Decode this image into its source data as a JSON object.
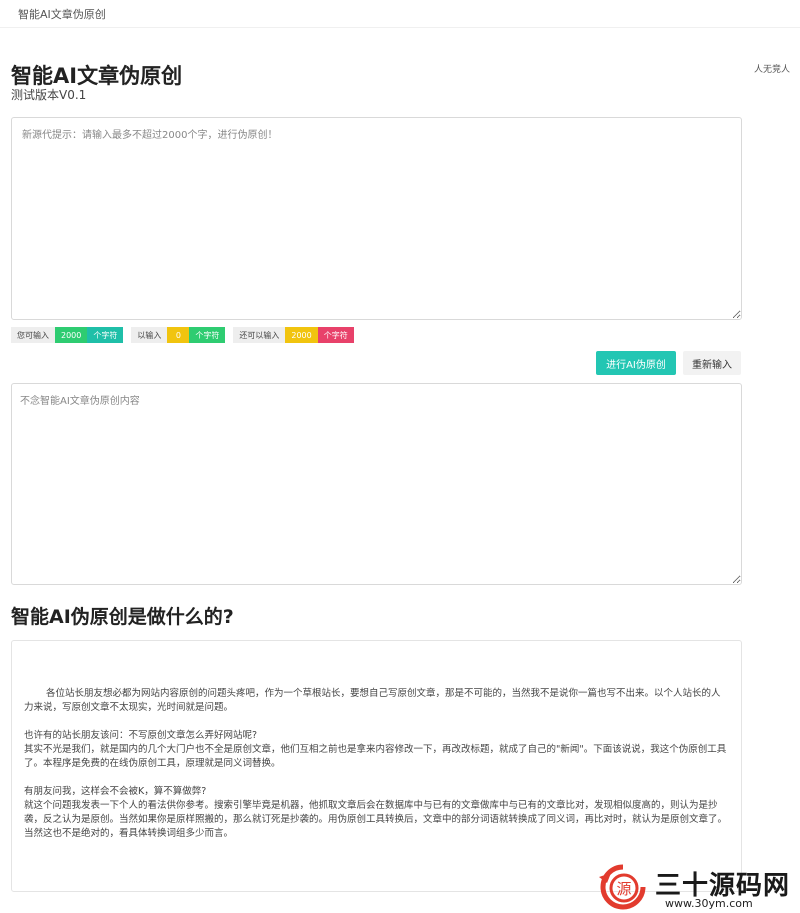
{
  "topbar": {
    "brand": "智能AI文章伪原创"
  },
  "aside_note": "人无竞人",
  "header": {
    "title": "智能AI文章伪原创",
    "subtitle": "测试版本V0.1"
  },
  "input": {
    "placeholder": "新源代提示：请输入最多不超过2000个字，进行伪原创！",
    "value": ""
  },
  "counters": [
    {
      "label": "您可输入",
      "value": "2000",
      "unit": "个字符",
      "color": "#2ecc71",
      "unit_color": "#1fbfa8"
    },
    {
      "label": "以输入",
      "value": "0",
      "unit": "个字符",
      "color": "#f1c40f",
      "unit_color": "#2ecc71"
    },
    {
      "label": "还可以输入",
      "value": "2000",
      "unit": "个字符",
      "color": "#f1c40f",
      "unit_color": "#e8416a"
    }
  ],
  "buttons": {
    "submit": "进行AI伪原创",
    "reset": "重新输入",
    "primary_color": "#23c6b3"
  },
  "output": {
    "placeholder": "不念智能AI文章伪原创内容",
    "value": ""
  },
  "section": {
    "title": "智能AI伪原创是做什么的?",
    "paragraphs": [
      "各位站长朋友想必都为网站内容原创的问题头疼吧，作为一个草根站长，要想自己写原创文章，那是不可能的，当然我不是说你一篇也写不出来。以个人站长的人力来说，写原创文章不太现实，光时间就是问题。",
      "也许有的站长朋友该问：不写原创文章怎么弄好网站呢?\n其实不光是我们，就是国内的几个大门户也不全是原创文章，他们互相之前也是拿来内容修改一下，再改改标题，就成了自己的\"新闻\"。下面该说说，我这个伪原创工具了。本程序是免费的在线伪原创工具，原理就是同义词替换。",
      "有朋友问我，这样会不会被K，算不算做弊?\n就这个问题我发表一下个人的看法供你参考。搜索引擎毕竟是机器，他抓取文章后会在数据库中与已有的文章做库中与已有的文章比对，发现相似度高的，则认为是抄袭，反之认为是原创。当然如果你是原样照搬的，那么就订死是抄袭的。用伪原创工具转换后，文章中的部分词语就转换成了同义词，再比对时，就认为是原创文章了。当然这也不是绝对的，看具体转换词组多少而言。"
    ]
  },
  "watermark": {
    "logo_text": "源",
    "text": "三十源码网",
    "url": "www.30ym.com"
  }
}
